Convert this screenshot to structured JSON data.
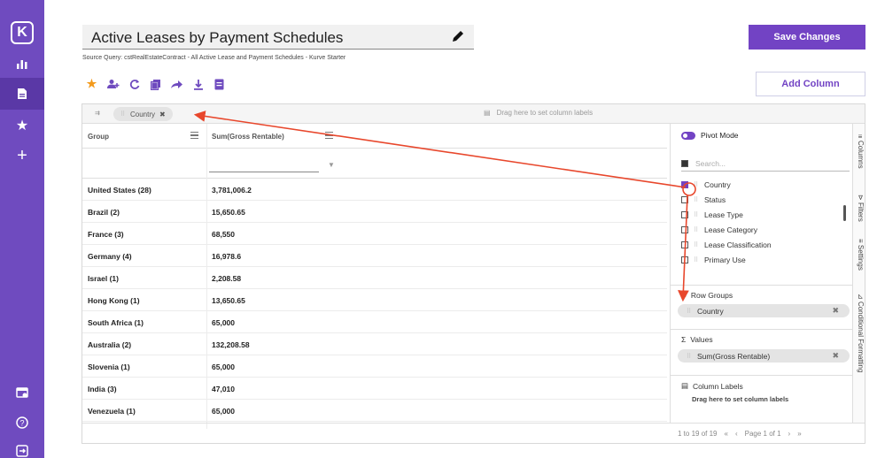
{
  "app": {
    "logo_letter": "K"
  },
  "header": {
    "title": "Active Leases by Payment Schedules",
    "subtitle": "Source Query: cstRealEstateContract - All Active Lease and Payment Schedules - Kurve Starter",
    "save_label": "Save Changes",
    "add_column_label": "Add Column"
  },
  "toolbar": {
    "icons": [
      "star-icon",
      "add-user-icon",
      "refresh-icon",
      "copy-icon",
      "share-icon",
      "download-icon",
      "document-icon"
    ]
  },
  "grid": {
    "column_label_drop_hint": "Drag here to set column labels",
    "row_group_chip": "Country",
    "headers": {
      "group": "Group",
      "value": "Sum(Gross Rentable)"
    },
    "rows": [
      {
        "group": "United States (28)",
        "value": "3,781,006.2"
      },
      {
        "group": "Brazil (2)",
        "value": "15,650.65"
      },
      {
        "group": "France (3)",
        "value": "68,550"
      },
      {
        "group": "Germany (4)",
        "value": "16,978.6"
      },
      {
        "group": "Israel (1)",
        "value": "2,208.58"
      },
      {
        "group": "Hong Kong (1)",
        "value": "13,650.65"
      },
      {
        "group": "South Africa (1)",
        "value": "65,000"
      },
      {
        "group": "Australia (2)",
        "value": "132,208.58"
      },
      {
        "group": "Slovenia (1)",
        "value": "65,000"
      },
      {
        "group": "India (3)",
        "value": "47,010"
      },
      {
        "group": "Venezuela (1)",
        "value": "65,000"
      }
    ],
    "pagination": {
      "range": "1 to 19 of 19",
      "page": "Page 1 of 1"
    }
  },
  "panel": {
    "pivot_mode_label": "Pivot Mode",
    "search_placeholder": "Search...",
    "columns": [
      {
        "label": "Country",
        "checked": true
      },
      {
        "label": "Status",
        "checked": false
      },
      {
        "label": "Lease Type",
        "checked": false
      },
      {
        "label": "Lease Category",
        "checked": false
      },
      {
        "label": "Lease Classification",
        "checked": false
      },
      {
        "label": "Primary Use",
        "checked": false
      }
    ],
    "row_groups_title": "Row Groups",
    "row_groups_chip": "Country",
    "values_title": "Values",
    "values_chip": "Sum(Gross Rentable)",
    "column_labels_title": "Column Labels",
    "column_labels_hint": "Drag here to set column labels",
    "tabs": [
      "Columns",
      "Filters",
      "Settings",
      "Conditional Formatting"
    ]
  },
  "colors": {
    "brand": "#6f4bbf",
    "accent": "#7243c4",
    "annotation_arrow": "#e8472c",
    "star": "#f39a1c"
  }
}
